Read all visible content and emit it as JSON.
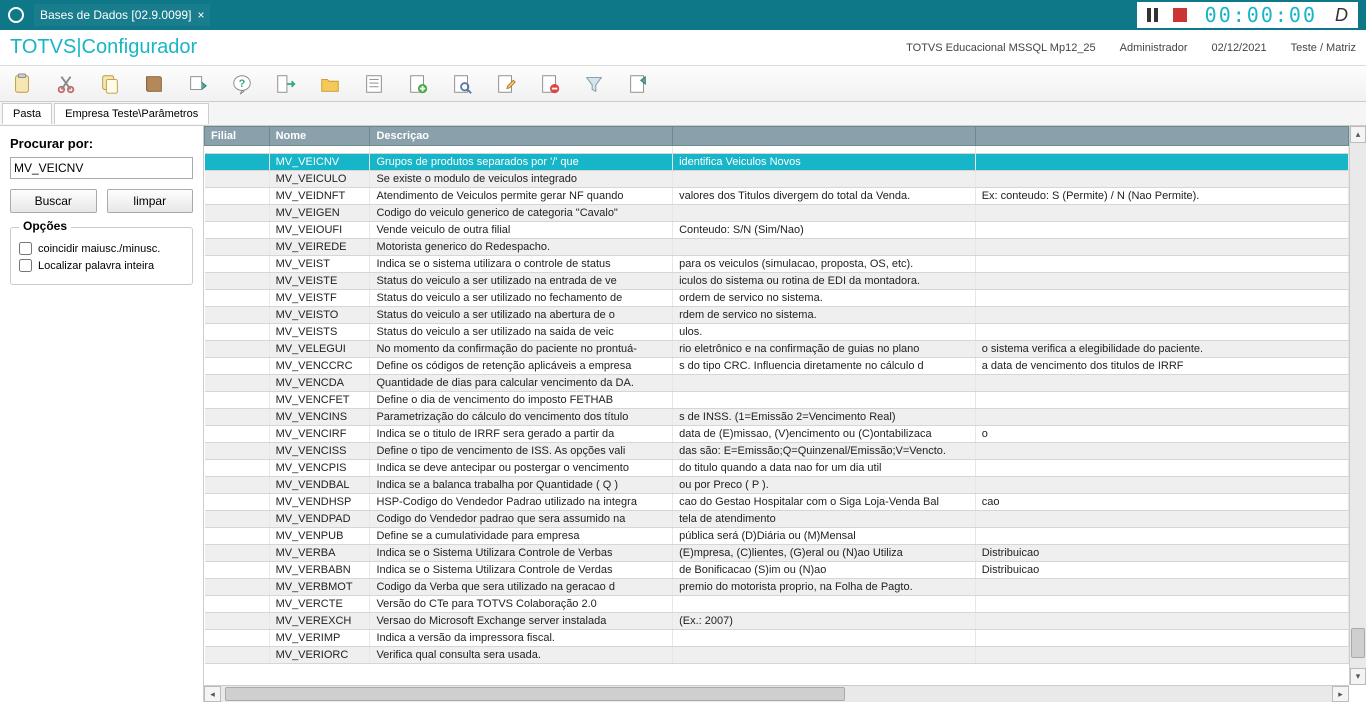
{
  "topbar": {
    "tab_label": "Bases de Dados [02.9.0099]",
    "timer": "00:00:00"
  },
  "title": {
    "brand": "TOTVS",
    "separator": " | ",
    "module": "Configurador",
    "right1": "TOTVS Educacional MSSQL Mp12_25",
    "right2": "Administrador",
    "right3": "02/12/2021",
    "right4": "Teste / Matriz"
  },
  "breadcrumb": {
    "item1": "Pasta",
    "item2": "Empresa Teste\\Parâmetros"
  },
  "sidebar": {
    "search_label": "Procurar por:",
    "search_value": "MV_VEICNV",
    "btn_buscar": "Buscar",
    "btn_limpar": "limpar",
    "opcoes_title": "Opções",
    "chk1": "coincidir maiusc./minusc.",
    "chk2": "Localizar palavra inteira"
  },
  "grid_headers": {
    "filial": "Filial",
    "nome": "Nome",
    "descricao": "Descriçao"
  },
  "rows": [
    {
      "nome": "MV_VEICNV",
      "desc": "Grupos de produtos separados por '/' que",
      "c4": "identifica Veiculos Novos",
      "c5": "",
      "selected": true
    },
    {
      "nome": "MV_VEICULO",
      "desc": "Se existe o modulo de veiculos integrado",
      "c4": "",
      "c5": ""
    },
    {
      "nome": "MV_VEIDNFT",
      "desc": "Atendimento de Veiculos permite gerar NF quando",
      "c4": " valores dos Titulos divergem do total da Venda.",
      "c5": "Ex: conteudo: S (Permite) / N (Nao Permite)."
    },
    {
      "nome": "MV_VEIGEN",
      "desc": "Codigo do veiculo generico de categoria \"Cavalo\"",
      "c4": "",
      "c5": ""
    },
    {
      "nome": "MV_VEIOUFI",
      "desc": "Vende veiculo de outra filial",
      "c4": "Conteudo: S/N (Sim/Nao)",
      "c5": ""
    },
    {
      "nome": "MV_VEIREDE",
      "desc": "Motorista generico do Redespacho.",
      "c4": "",
      "c5": ""
    },
    {
      "nome": "MV_VEIST",
      "desc": "Indica se o sistema utilizara o controle de status",
      "c4": " para os veiculos (simulacao, proposta, OS, etc).",
      "c5": ""
    },
    {
      "nome": "MV_VEISTE",
      "desc": "Status do veiculo a ser utilizado na entrada de ve",
      "c4": "iculos do sistema ou rotina de EDI da montadora.",
      "c5": ""
    },
    {
      "nome": "MV_VEISTF",
      "desc": "Status do veiculo a ser utilizado no fechamento de",
      "c4": " ordem de servico no sistema.",
      "c5": ""
    },
    {
      "nome": "MV_VEISTO",
      "desc": "Status do veiculo a ser utilizado na abertura de o",
      "c4": "rdem de servico no sistema.",
      "c5": ""
    },
    {
      "nome": "MV_VEISTS",
      "desc": "Status do veiculo a ser utilizado na saida de veic",
      "c4": "ulos.",
      "c5": ""
    },
    {
      "nome": "MV_VELEGUI",
      "desc": "No momento da confirmação do paciente no prontuá-",
      "c4": "rio eletrônico e na confirmação de guias no plano",
      "c5": "o sistema verifica a elegibilidade do paciente."
    },
    {
      "nome": "MV_VENCCRC",
      "desc": "Define os códigos de retenção aplicáveis a empresa",
      "c4": "s do tipo CRC. Influencia diretamente no cálculo d",
      "c5": "a data de vencimento dos titulos de IRRF"
    },
    {
      "nome": "MV_VENCDA",
      "desc": "Quantidade de dias para calcular vencimento da DA.",
      "c4": "",
      "c5": ""
    },
    {
      "nome": "MV_VENCFET",
      "desc": "Define o dia de vencimento do imposto FETHAB",
      "c4": "",
      "c5": ""
    },
    {
      "nome": "MV_VENCINS",
      "desc": "Parametrização do cálculo do vencimento dos título",
      "c4": "s de INSS. (1=Emissão 2=Vencimento Real)",
      "c5": ""
    },
    {
      "nome": "MV_VENCIRF",
      "desc": "Indica se o titulo de IRRF sera gerado a partir da",
      "c4": "data de (E)missao, (V)encimento ou (C)ontabilizaca",
      "c5": "o"
    },
    {
      "nome": "MV_VENCISS",
      "desc": "Define o tipo de vencimento de ISS. As opções vali",
      "c4": "das são: E=Emissão;Q=Quinzenal/Emissão;V=Vencto.",
      "c5": ""
    },
    {
      "nome": "MV_VENCPIS",
      "desc": "Indica se deve antecipar ou postergar o vencimento",
      "c4": "do titulo quando a data nao for um dia util",
      "c5": ""
    },
    {
      "nome": "MV_VENDBAL",
      "desc": "Indica se a balanca trabalha por Quantidade ( Q )",
      "c4": "ou por Preco ( P ).",
      "c5": ""
    },
    {
      "nome": "MV_VENDHSP",
      "desc": "HSP-Codigo do Vendedor Padrao utilizado na integra",
      "c4": "cao do Gestao Hospitalar com o Siga Loja-Venda Bal",
      "c5": "cao"
    },
    {
      "nome": "MV_VENDPAD",
      "desc": "Codigo do Vendedor padrao que sera assumido na",
      "c4": "tela de atendimento",
      "c5": ""
    },
    {
      "nome": "MV_VENPUB",
      "desc": "Define se a cumulatividade para empresa",
      "c4": "pública será (D)Diária ou (M)Mensal",
      "c5": ""
    },
    {
      "nome": "MV_VERBA",
      "desc": "Indica se o Sistema Utilizara Controle de Verbas",
      "c4": "(E)mpresa, (C)lientes, (G)eral ou (N)ao Utiliza",
      "c5": "Distribuicao"
    },
    {
      "nome": "MV_VERBABN",
      "desc": "Indica se o Sistema Utilizara Controle de Verdas",
      "c4": "de Bonificacao (S)im ou (N)ao",
      "c5": "Distribuicao"
    },
    {
      "nome": "MV_VERBMOT",
      "desc": "Codigo da Verba que sera utilizado na geracao d",
      "c4": "premio do motorista proprio, na Folha de Pagto.",
      "c5": ""
    },
    {
      "nome": "MV_VERCTE",
      "desc": "Versão do CTe para TOTVS Colaboração 2.0",
      "c4": "",
      "c5": ""
    },
    {
      "nome": "MV_VEREXCH",
      "desc": "Versao do Microsoft Exchange server instalada",
      "c4": "(Ex.: 2007)",
      "c5": ""
    },
    {
      "nome": "MV_VERIMP",
      "desc": "Indica a versão da impressora fiscal.",
      "c4": "",
      "c5": ""
    },
    {
      "nome": "MV_VERIORC",
      "desc": "Verifica qual consulta sera usada.",
      "c4": "",
      "c5": ""
    }
  ]
}
